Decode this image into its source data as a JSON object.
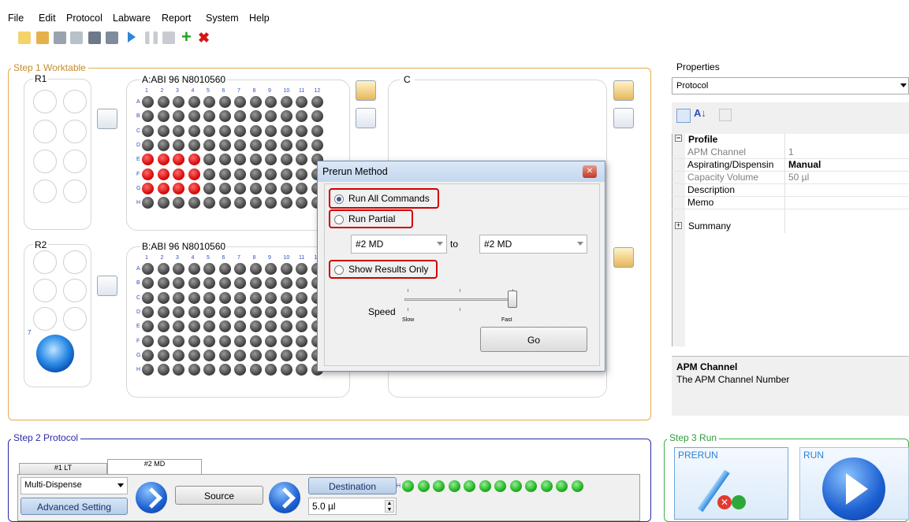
{
  "menu": [
    "File",
    "Edit",
    "Protocol",
    "Labware",
    "Report",
    "System",
    "Help"
  ],
  "toolbar": {
    "icons": [
      "new-icon",
      "open-icon",
      "save-icon",
      "save-as-icon",
      "print-icon",
      "print-preview-icon",
      "run-icon",
      "pause-icon",
      "stop-icon",
      "add-icon",
      "delete-icon"
    ]
  },
  "worktable": {
    "title": "Step 1 Worktable",
    "r1": "R1",
    "r2": "R2",
    "r2_number": "7",
    "plate_a": "A:ABI 96 N8010560",
    "plate_b": "B:ABI 96 N8010560",
    "plate_c": "C",
    "columns": [
      "1",
      "2",
      "3",
      "4",
      "5",
      "6",
      "7",
      "8",
      "9",
      "10",
      "11",
      "12"
    ],
    "rows": [
      "A",
      "B",
      "C",
      "D",
      "E",
      "F",
      "G",
      "H"
    ],
    "plate_a_red_rows": [
      "E",
      "F",
      "G"
    ],
    "plate_a_red_cols": 4,
    "plate_c_row": "H",
    "colors": {
      "red": "#d20000",
      "green": "#14a614",
      "dark": "#3a3a3a"
    }
  },
  "dialog": {
    "title": "Prerun Method",
    "run_all": "Run All Commands",
    "run_partial": "Run Partial",
    "show_results": "Show Results Only",
    "from_value": "#2 MD",
    "to_label": "to",
    "to_value": "#2 MD",
    "speed_label": "Speed",
    "slow_label": "Slow",
    "fast_label": "Fast",
    "go_label": "Go",
    "selected": "run_all"
  },
  "properties": {
    "title": "Properties",
    "object": "Protocol",
    "category": "Profile",
    "rows": [
      {
        "name": "APM Channel",
        "value": "1",
        "muted": true,
        "bold": false
      },
      {
        "name": "Aspirating/Dispensin",
        "value": "Manual",
        "muted": false,
        "bold": true
      },
      {
        "name": "Capacity Volume",
        "value": "50 µl",
        "muted": true,
        "bold": false
      },
      {
        "name": "Description",
        "value": "",
        "muted": false,
        "bold": false
      },
      {
        "name": "Memo",
        "value": "",
        "muted": false,
        "bold": false
      }
    ],
    "summary": "Summany",
    "desc_title": "APM Channel",
    "desc_text": "The APM Channel Number"
  },
  "step2": {
    "title": "Step 2 Protocol",
    "tabs": [
      "#1 LT",
      "#2 MD"
    ],
    "active_tab": "#2 MD",
    "dispense_mode": "Multi-Dispense",
    "advanced": "Advanced Setting",
    "source": "Source",
    "destination": "Destination",
    "volume": "5.0 µl"
  },
  "step3": {
    "title": "Step 3 Run",
    "prerun": "PRERUN",
    "run": "RUN"
  }
}
